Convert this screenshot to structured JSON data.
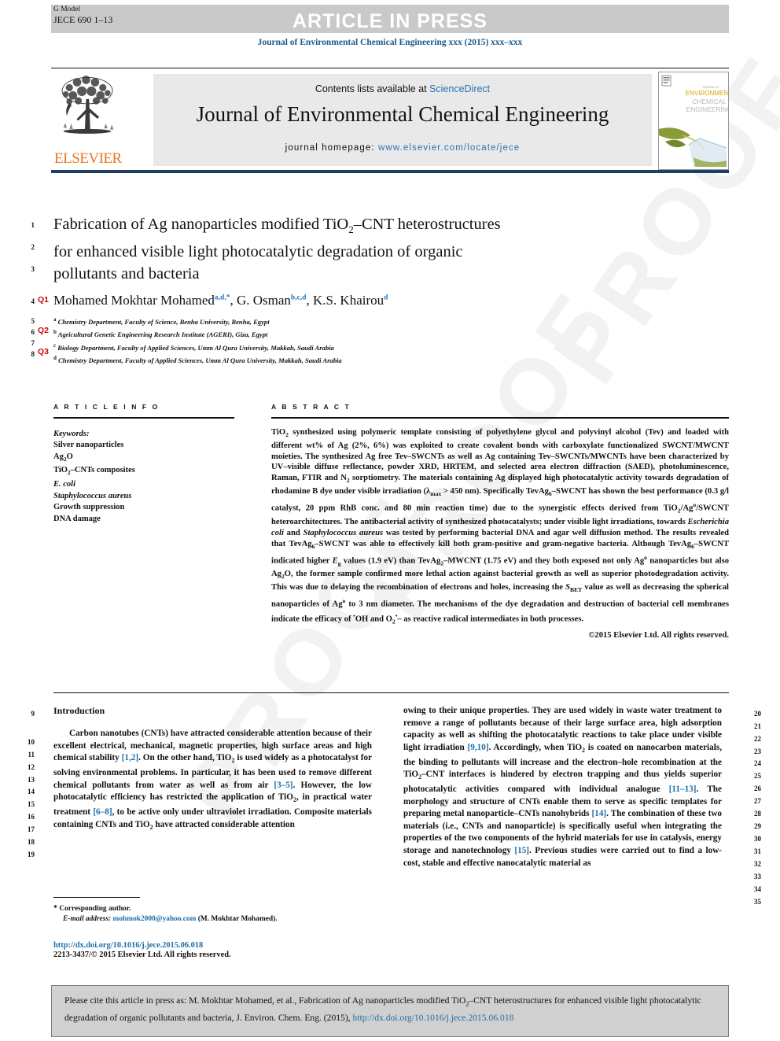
{
  "header": {
    "g_model_l1": "G Model",
    "g_model_l2": "JECE 690 1–13",
    "article_in_press": "ARTICLE IN PRESS",
    "journal_citation_line": "Journal of Environmental Chemical Engineering xxx (2015) xxx–xxx"
  },
  "masthead": {
    "contents_prefix": "Contents lists available at ",
    "sciencedirect": "ScienceDirect",
    "journal_title": "Journal of Environmental Chemical Engineering",
    "homepage_label": "journal homepage: ",
    "homepage_url": "www.elsevier.com/locate/jece",
    "publisher": "ELSEVIER",
    "cover_title_l1": "ENVIRONMENTAL",
    "cover_title_l2": "CHEMICAL",
    "cover_title_l3": "ENGINEERING",
    "cover_kicker": "JOURNAL OF"
  },
  "article": {
    "title_line1": "Fabrication of Ag nanoparticles modified TiO",
    "title_sub1": "2",
    "title_line1b": "–CNT heterostructures",
    "title_line2": "for enhanced visible light photocatalytic degradation of organic",
    "title_line3": "pollutants and bacteria",
    "authors": [
      {
        "name": "Mohamed Mokhtar Mohamed",
        "sup": "a,d,*"
      },
      {
        "name": "G. Osman",
        "sup": "b,c,d"
      },
      {
        "name": "K.S. Khairou",
        "sup": "d"
      }
    ],
    "affiliations": [
      {
        "marker": "a",
        "text": "Chemistry Department, Faculty of Science, Benha University, Benha, Egypt"
      },
      {
        "marker": "b",
        "text": "Agricultural Genetic Engineering Research Institute (AGERI), Giza, Egypt"
      },
      {
        "marker": "c",
        "text": "Biology Department, Faculty of Applied Sciences, Umm Al Qura University, Makkah, Saudi Arabia"
      },
      {
        "marker": "d",
        "text": "Chemistry Department, Faculty of Applied Sciences, Umm Al Qura University, Makkah, Saudi Arabia"
      }
    ]
  },
  "query_tags": [
    "Q1",
    "Q2",
    "Q3"
  ],
  "line_numbers": {
    "left_title": [
      "1",
      "2",
      "3",
      "4",
      "5",
      "6",
      "7",
      "8"
    ],
    "left_body": [
      "9",
      "10",
      "11",
      "12",
      "13",
      "14",
      "15",
      "16",
      "17",
      "18",
      "19"
    ],
    "right_body": [
      "20",
      "21",
      "22",
      "23",
      "24",
      "25",
      "26",
      "27",
      "28",
      "29",
      "30",
      "31",
      "32",
      "33",
      "34",
      "35"
    ]
  },
  "article_info": {
    "heading": "A R T I C L E  I N F O",
    "keywords_label": "Keywords:",
    "keywords": [
      "Silver nanoparticles",
      "Ag2O",
      "TiO2–CNTs composites",
      "E. coli",
      "Staphylococcus aureus",
      "Growth suppression",
      "DNA damage"
    ]
  },
  "abstract": {
    "heading": "A B S T R A C T",
    "text": "TiO2 synthesized using polymeric template consisting of polyethylene glycol and polyvinyl alcohol (Tev) and loaded with different wt% of Ag (2%, 6%) was exploited to create covalent bonds with carboxylate functionalized SWCNT/MWCNT moieties. The synthesized Ag free Tev–SWCNTs as well as Ag containing Tev–SWCNTs/MWCNTs have been characterized by UV–visible diffuse reflectance, powder XRD, HRTEM, and selected area electron diffraction (SAED), photoluminescence, Raman, FTIR and N2 sorptiometry. The materials containing Ag displayed high photocatalytic activity towards degradation of rhodamine B dye under visible irradiation (λmax > 450 nm). Specifically TevAg6–SWCNT has shown the best performance (0.3 g/l catalyst, 20 ppm RhB conc. and 80 min reaction time) due to the synergistic effects derived from TiO2/Ag°/SWCNT heteroarchitectures. The antibacterial activity of synthesized photocatalysts; under visible light irradiations, towards Escherichia coli and Staphylococcus aureus was tested by performing bacterial DNA and agar well diffusion method. The results revealed that TevAg6–SWCNT was able to effectively kill both gram-positive and gram-negative bacteria. Although TevAg6–SWCNT indicated higher Eg values (1.9 eV) than TevAg2–MWCNT (1.75 eV) and they both exposed not only Ag° nanoparticles but also Ag2O, the former sample confirmed more lethal action against bacterial growth as well as superior photodegradation activity. This was due to delaying the recombination of electrons and holes, increasing the SBET value as well as decreasing the spherical nanoparticles of Ag° to 3 nm diameter. The mechanisms of the dye degradation and destruction of bacterial cell membranes indicate the efficacy of °OH and O2°– as reactive radical intermediates in both processes.",
    "copyright": "©2015 Elsevier Ltd. All rights reserved."
  },
  "introduction": {
    "heading": "Introduction",
    "left_paragraph": "Carbon nanotubes (CNTs) have attracted considerable attention because of their excellent electrical, mechanical, magnetic properties, high surface areas and high chemical stability [1,2]. On the other hand, TiO2 is used widely as a photocatalyst for solving environmental problems. In particular, it has been used to remove different chemical pollutants from water as well as from air [3–5]. However, the low photocatalytic efficiency has restricted the application of TiO2, in practical water treatment [6–8], to be active only under ultraviolet irradiation. Composite materials containing CNTs and TiO2 have attracted considerable attention",
    "right_paragraph": "owing to their unique properties. They are used widely in waste water treatment to remove a range of pollutants because of their large surface area, high adsorption capacity as well as shifting the photocatalytic reactions to take place under visible light irradiation [9,10]. Accordingly, when TiO2 is coated on nanocarbon materials, the binding to pollutants will increase and the electron–hole recombination at the TiO2–CNT interfaces is hindered by electron trapping and thus yields superior photocatalytic activities compared with individual analogue [11–13]. The morphology and structure of CNTs enable them to serve as specific templates for preparing metal nanoparticle–CNTs nanohybrids [14]. The combination of these two materials (i.e., CNTs and nanoparticle) is specifically useful when integrating the properties of the two components of the hybrid materials for use in catalysis, energy storage and nanotechnology [15]. Previous studies were carried out to find a low-cost, stable and effective nanocatalytic material as"
  },
  "footnote": {
    "corresponding": "Corresponding author.",
    "email_label": "E-mail address:",
    "email": "mohmok2000@yahoo.com",
    "email_owner": "(M. Mokhtar Mohamed).",
    "doi": "http://dx.doi.org/10.1016/j.jece.2015.06.018",
    "issn_line": "2213-3437/© 2015 Elsevier Ltd. All rights reserved."
  },
  "citation_box": {
    "text_part1": "Please cite this article in press as: M. Mokhtar Mohamed, et al., Fabrication of Ag nanoparticles modified TiO",
    "sub": "2",
    "text_part2": "–CNT heterostructures for enhanced visible light photocatalytic degradation of organic pollutants and bacteria, J. Environ. Chem. Eng. (2015), ",
    "link": "http://dx.doi.org/10.1016/j.jece.2015.06.018"
  },
  "watermark": {
    "word_top": "PROOF",
    "word_mid": "PROOF",
    "word_bottom": "PROOF"
  },
  "colors": {
    "link_blue": "#1c6ea8",
    "header_blue": "#1a5a8e",
    "query_red": "#d3000b",
    "elsevier_orange": "#e87722",
    "bar_grey": "#c9c9c9",
    "rule_navy": "#1c3f63"
  }
}
